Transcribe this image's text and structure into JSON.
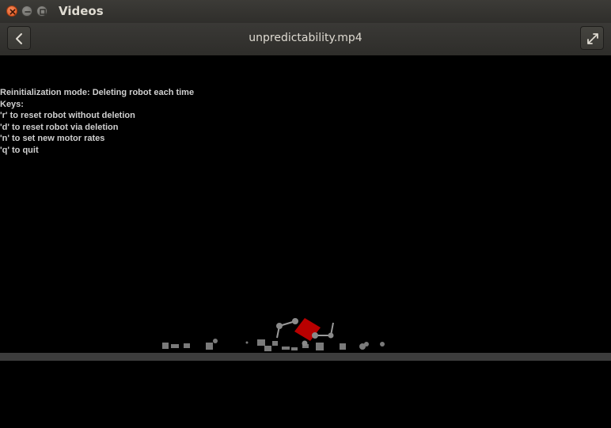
{
  "window": {
    "app_title": "Videos",
    "close_icon": "close-icon",
    "minimize_icon": "minimize-icon",
    "maximize_icon": "maximize-icon"
  },
  "header": {
    "file_title": "unpredictability.mp4",
    "back_icon": "chevron-left-icon",
    "fullscreen_icon": "fullscreen-icon"
  },
  "video": {
    "overlay_lines": [
      "Reinitialization mode: Deleting robot each time",
      "Keys:",
      "'r' to reset robot without deletion",
      "'d' to reset robot via deletion",
      "'n' to set new motor rates",
      "'q' to quit"
    ],
    "colors": {
      "background": "#000000",
      "ground": "#3c3c3c",
      "debris": "#7a7a7a",
      "robot_body": "#b80000"
    }
  }
}
